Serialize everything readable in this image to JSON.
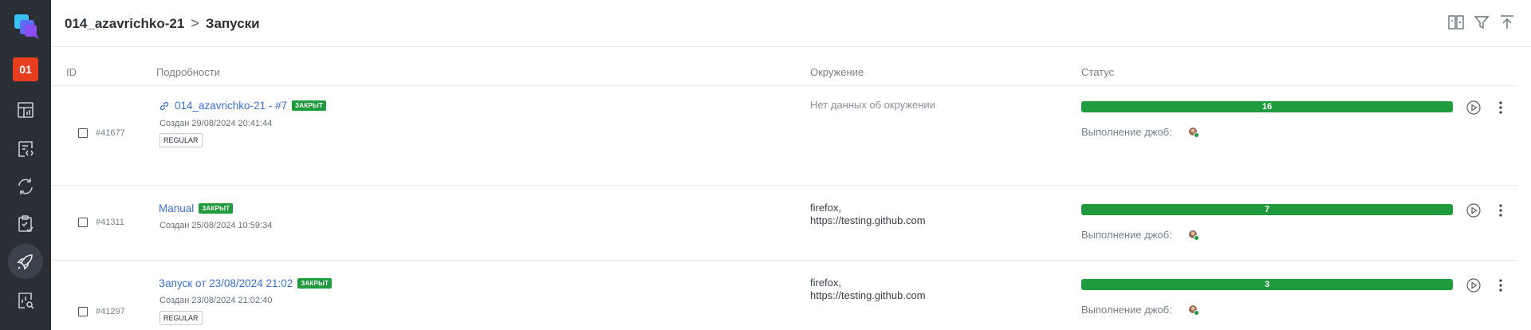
{
  "sidebar": {
    "project_badge": "01",
    "icons": [
      "dashboard-icon",
      "test-cases-icon",
      "sync-icon",
      "checklist-icon",
      "launches-icon",
      "analytics-icon"
    ]
  },
  "header": {
    "project": "014_azavrichko-21",
    "separator": ">",
    "page": "Запуски"
  },
  "columns": {
    "id": "ID",
    "details": "Подробности",
    "environment": "Окружение",
    "status": "Статус"
  },
  "rows": [
    {
      "id": "#41677",
      "title": "014_azavrichko-21 - #7",
      "badge": "ЗАКРЫТ",
      "created": "Создан 29/08/2024 20:41:44",
      "tag": "REGULAR",
      "env_line1": "Нет данных об окружении",
      "env_line2": "",
      "count": "16",
      "jobs_label": "Выполнение джоб:"
    },
    {
      "id": "#41311",
      "title": "Manual",
      "badge": "ЗАКРЫТ",
      "created": "Создан 25/08/2024 10:59:34",
      "tag": "",
      "env_line1": "firefox,",
      "env_line2": "https://testing.github.com",
      "count": "7",
      "jobs_label": "Выполнение джоб:"
    },
    {
      "id": "#41297",
      "title": "Запуск от 23/08/2024 21:02",
      "badge": "ЗАКРЫТ",
      "created": "Создан 23/08/2024 21:02:40",
      "tag": "REGULAR",
      "env_line1": "firefox,",
      "env_line2": "https://testing.github.com",
      "count": "3",
      "jobs_label": "Выполнение джоб:"
    }
  ],
  "colors": {
    "sidebar_bg": "#2a2e35",
    "project_badge": "#e63e1f",
    "status_green": "#1f9a3c",
    "link_blue": "#3d6fd9"
  }
}
